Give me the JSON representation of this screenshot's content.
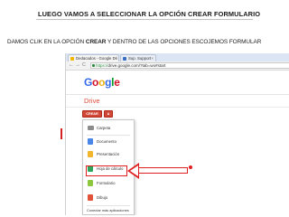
{
  "slide": {
    "title": "LUEGO VAMOS A  SELECCIONAR LA OPCIÓN CREAR FORMULARIO",
    "subtitle_pre": "DAMOS CLIK EN LA OPCIÓN ",
    "subtitle_bold": "CREAR",
    "subtitle_post": " Y DENTRO DE LAS OPCIONES ESCOJEMOS FORMULAR"
  },
  "browser": {
    "tabs": [
      {
        "label": "Dedacados - Google Dri",
        "close": "×"
      },
      {
        "label": "Sup. Support",
        "close": "×"
      }
    ],
    "nav": {
      "back": "←",
      "forward": "→",
      "reload": "C"
    },
    "url_scheme": "https://",
    "url_rest": "drive.google.com/?tab=wo#start"
  },
  "app": {
    "logo_letters": [
      "G",
      "o",
      "o",
      "g",
      "l",
      "e"
    ],
    "product": "Drive",
    "create_label": "CREAR",
    "side_arrow": "▸",
    "menu_items": [
      {
        "label": "Carpeta",
        "icon": "folder-icon"
      },
      {
        "label": "Documento",
        "icon": "document-icon"
      },
      {
        "label": "Presentación",
        "icon": "presentation-icon"
      },
      {
        "label": "Hoja de cálculo",
        "icon": "spreadsheet-icon"
      },
      {
        "label": "Formulario",
        "icon": "form-icon"
      },
      {
        "label": "Dibujo",
        "icon": "drawing-icon"
      }
    ],
    "connect_label": "Conectar más aplicaciones"
  },
  "colors": {
    "accent_red": "#e02020",
    "create_button": "#d14836",
    "drive_label": "#dd4b39"
  }
}
